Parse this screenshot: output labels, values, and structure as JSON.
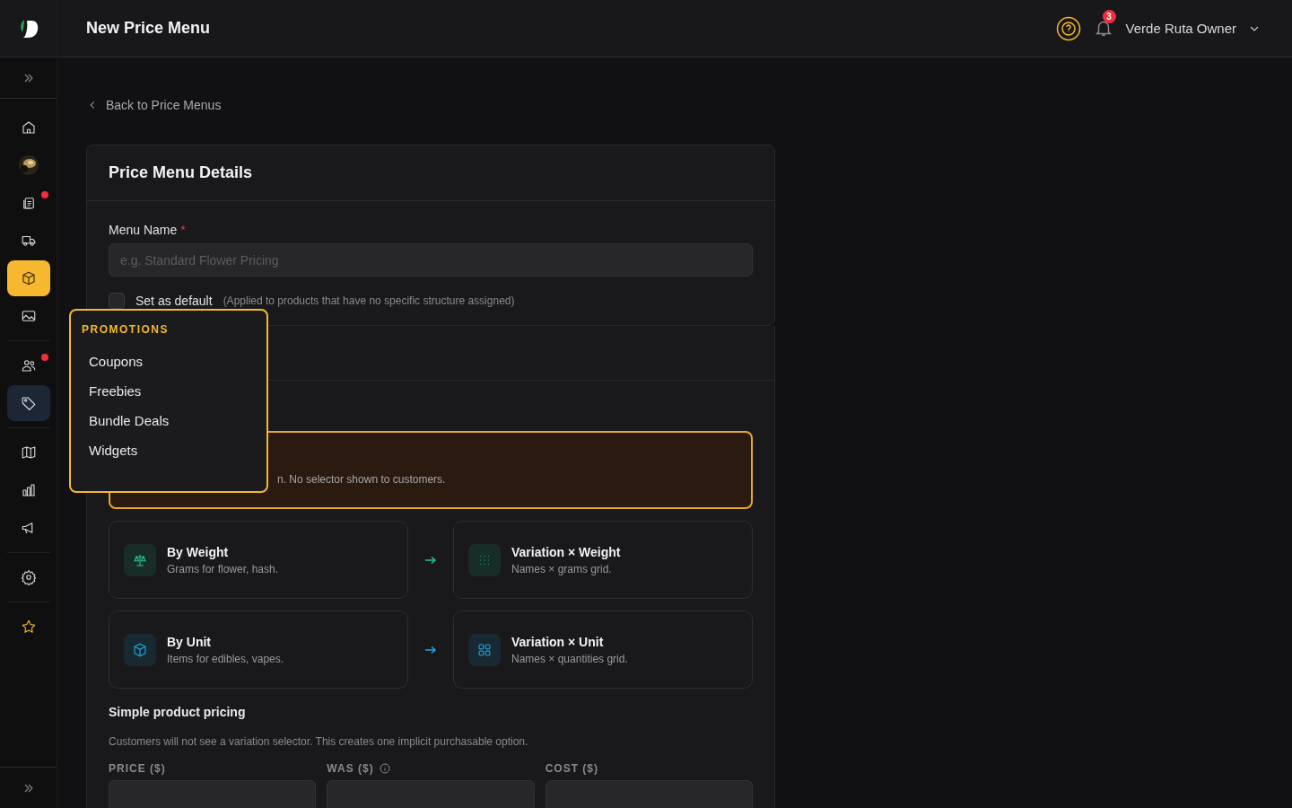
{
  "header": {
    "title": "New Price Menu",
    "notifications": "3",
    "user": "Verde Ruta Owner"
  },
  "sidebar": {
    "items": [
      {
        "kind": "icon",
        "selected": false,
        "dot": false
      },
      {
        "kind": "picture",
        "selected": false,
        "dot": false
      },
      {
        "kind": "icon",
        "selected": false,
        "dot": true
      },
      {
        "kind": "icon",
        "selected": false,
        "dot": false
      },
      {
        "kind": "icon",
        "selected": true,
        "dot": false
      },
      {
        "kind": "icon",
        "selected": false,
        "dot": false
      },
      {
        "kind": "icon",
        "selected": false,
        "dot": true
      },
      {
        "kind": "icon",
        "selected": false,
        "dot": false,
        "expanded": true
      },
      {
        "kind": "icon",
        "selected": false,
        "dot": false
      },
      {
        "kind": "icon",
        "selected": false,
        "dot": false
      },
      {
        "kind": "icon",
        "selected": false,
        "dot": false
      },
      {
        "kind": "icon",
        "selected": false,
        "dot": false
      },
      {
        "kind": "favorite",
        "selected": false,
        "dot": false
      }
    ]
  },
  "back_link": "Back to Price Menus",
  "details": {
    "title": "Price Menu Details",
    "name_label": "Menu Name",
    "required": "*",
    "placeholder": "e.g. Standard Flower Pricing",
    "default_label": "Set as default",
    "default_checked": false,
    "default_hint": "(Applied to products that have no specific structure assigned)"
  },
  "structure": {
    "simple_option": {
      "selected": true,
      "description": "n. No selector shown to customers."
    },
    "rows": [
      {
        "color": "#22c58b",
        "left": {
          "kind": "weight",
          "title": "By Weight",
          "description": "Grams for flower, hash.",
          "selected": false
        },
        "right": {
          "kind": "dots",
          "title": "Variation × Weight",
          "description": "Names × grams grid.",
          "selected": false
        }
      },
      {
        "color": "#1ea7e0",
        "left": {
          "kind": "unit",
          "title": "By Unit",
          "description": "Items for edibles, vapes.",
          "selected": false
        },
        "right": {
          "kind": "grid",
          "title": "Variation × Unit",
          "description": "Names × quantities grid.",
          "selected": false
        }
      }
    ]
  },
  "simple_pricing": {
    "title": "Simple product pricing",
    "description": "Customers will not see a variation selector. This creates one implicit purchasable option.",
    "fields": [
      {
        "label": "PRICE ($)",
        "info": false
      },
      {
        "label": "WAS ($)",
        "info": true
      },
      {
        "label": "COST ($)",
        "info": false
      }
    ]
  },
  "popup": {
    "heading": "PROMOTIONS",
    "items": [
      "Coupons",
      "Freebies",
      "Bundle Deals",
      "Widgets"
    ]
  }
}
